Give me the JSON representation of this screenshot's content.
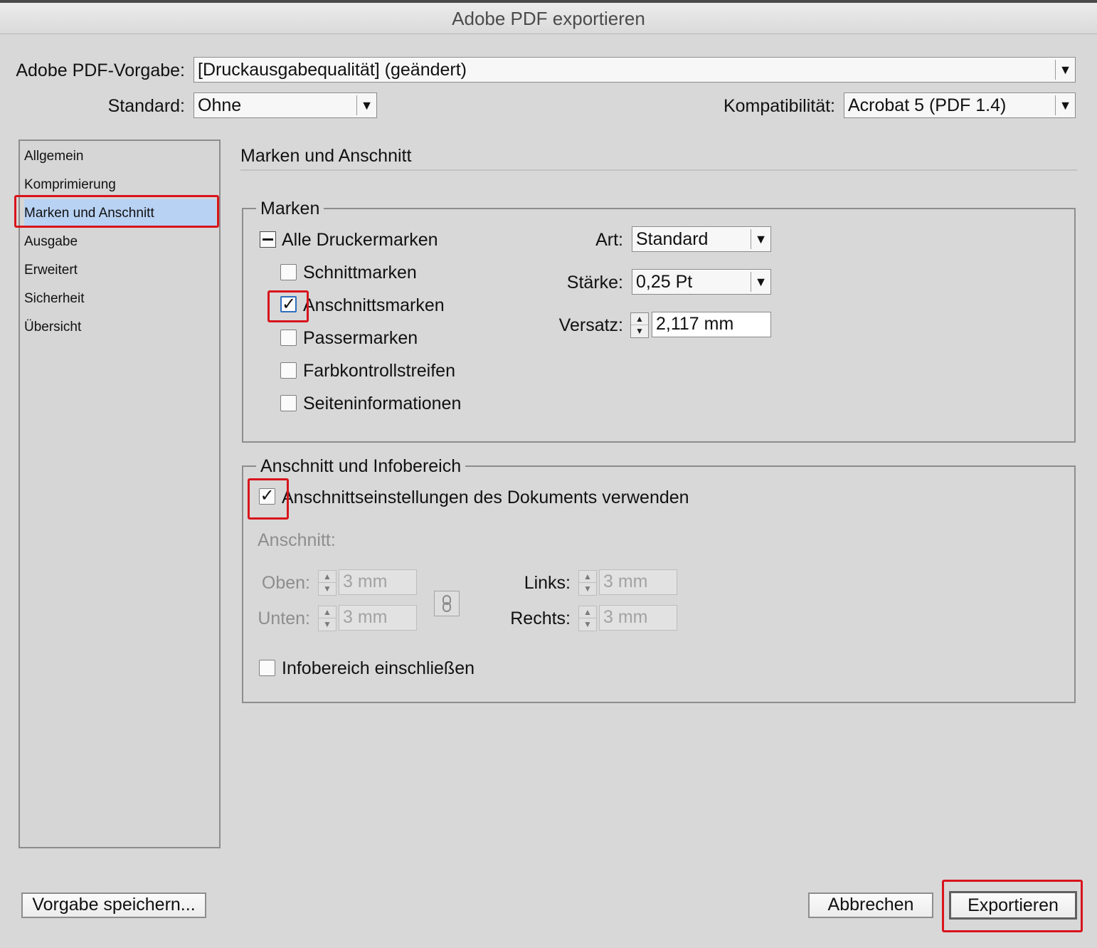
{
  "window": {
    "title": "Adobe PDF exportieren"
  },
  "header": {
    "preset_label": "Adobe PDF-Vorgabe:",
    "preset_value": "[Druckausgabequalität] (geändert)",
    "standard_label": "Standard:",
    "standard_value": "Ohne",
    "compat_label": "Kompatibilität:",
    "compat_value": "Acrobat 5 (PDF 1.4)"
  },
  "sidebar": {
    "items": [
      {
        "label": "Allgemein"
      },
      {
        "label": "Komprimierung"
      },
      {
        "label": "Marken und Anschnitt"
      },
      {
        "label": "Ausgabe"
      },
      {
        "label": "Erweitert"
      },
      {
        "label": "Sicherheit"
      },
      {
        "label": "Übersicht"
      }
    ],
    "selected": "Marken und Anschnitt"
  },
  "panel": {
    "title": "Marken und Anschnitt",
    "marks": {
      "legend": "Marken",
      "all_label": "Alle Druckermarken",
      "items": [
        {
          "label": "Schnittmarken",
          "checked": false
        },
        {
          "label": "Anschnittsmarken",
          "checked": true
        },
        {
          "label": "Passermarken",
          "checked": false
        },
        {
          "label": "Farbkontrollstreifen",
          "checked": false
        },
        {
          "label": "Seiteninformationen",
          "checked": false
        }
      ],
      "art_label": "Art:",
      "art_value": "Standard",
      "staerke_label": "Stärke:",
      "staerke_value": "0,25 Pt",
      "versatz_label": "Versatz:",
      "versatz_value": "2,117 mm"
    },
    "bleed": {
      "legend": "Anschnitt und Infobereich",
      "use_doc_label": "Anschnittseinstellungen des Dokuments verwenden",
      "use_doc_checked": true,
      "anschnitt_label": "Anschnitt:",
      "oben_label": "Oben:",
      "oben_value": "3 mm",
      "unten_label": "Unten:",
      "unten_value": "3 mm",
      "links_label": "Links:",
      "links_value": "3 mm",
      "rechts_label": "Rechts:",
      "rechts_value": "3 mm",
      "info_label": "Infobereich einschließen",
      "info_checked": false
    }
  },
  "footer": {
    "save_preset": "Vorgabe speichern...",
    "cancel": "Abbrechen",
    "export": "Exportieren"
  },
  "glyphs": {
    "check": "✓",
    "arrow": "▼",
    "up": "▲",
    "down": "▼",
    "chain": "⛓"
  },
  "colors": {
    "highlight_red": "#d8141c",
    "selection_blue": "#b8d2f4",
    "checkbox_focus": "#2e6fbf"
  }
}
